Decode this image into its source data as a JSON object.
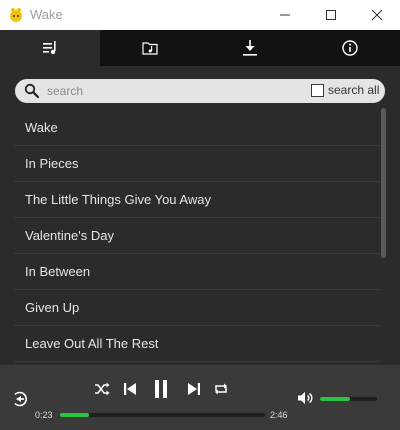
{
  "window": {
    "title": "Wake",
    "minimize_icon": "minimize-icon",
    "maximize_icon": "maximize-icon",
    "close_icon": "close-icon"
  },
  "tabs": [
    {
      "icon": "playlist-icon",
      "active": true
    },
    {
      "icon": "music-folder-icon",
      "active": false
    },
    {
      "icon": "download-icon",
      "active": false
    },
    {
      "icon": "info-icon",
      "active": false
    }
  ],
  "search": {
    "placeholder": "search",
    "value": "",
    "search_all_label": "search all",
    "search_all_checked": false
  },
  "tracks": [
    "Wake",
    "In Pieces",
    "The Little Things Give You Away",
    "Valentine's Day",
    "In Between",
    "Given Up",
    "Leave Out All The Rest",
    ""
  ],
  "player": {
    "current_time": "0:23",
    "total_time": "2:46",
    "progress_fraction": 0.14,
    "volume_fraction": 0.52,
    "state": "playing"
  },
  "colors": {
    "accent": "#29c442",
    "tab_active": "#2b2b2b",
    "tabbar_bg": "#121212",
    "content_bg": "#2b2b2b",
    "player_bg": "#3a3a3a"
  }
}
